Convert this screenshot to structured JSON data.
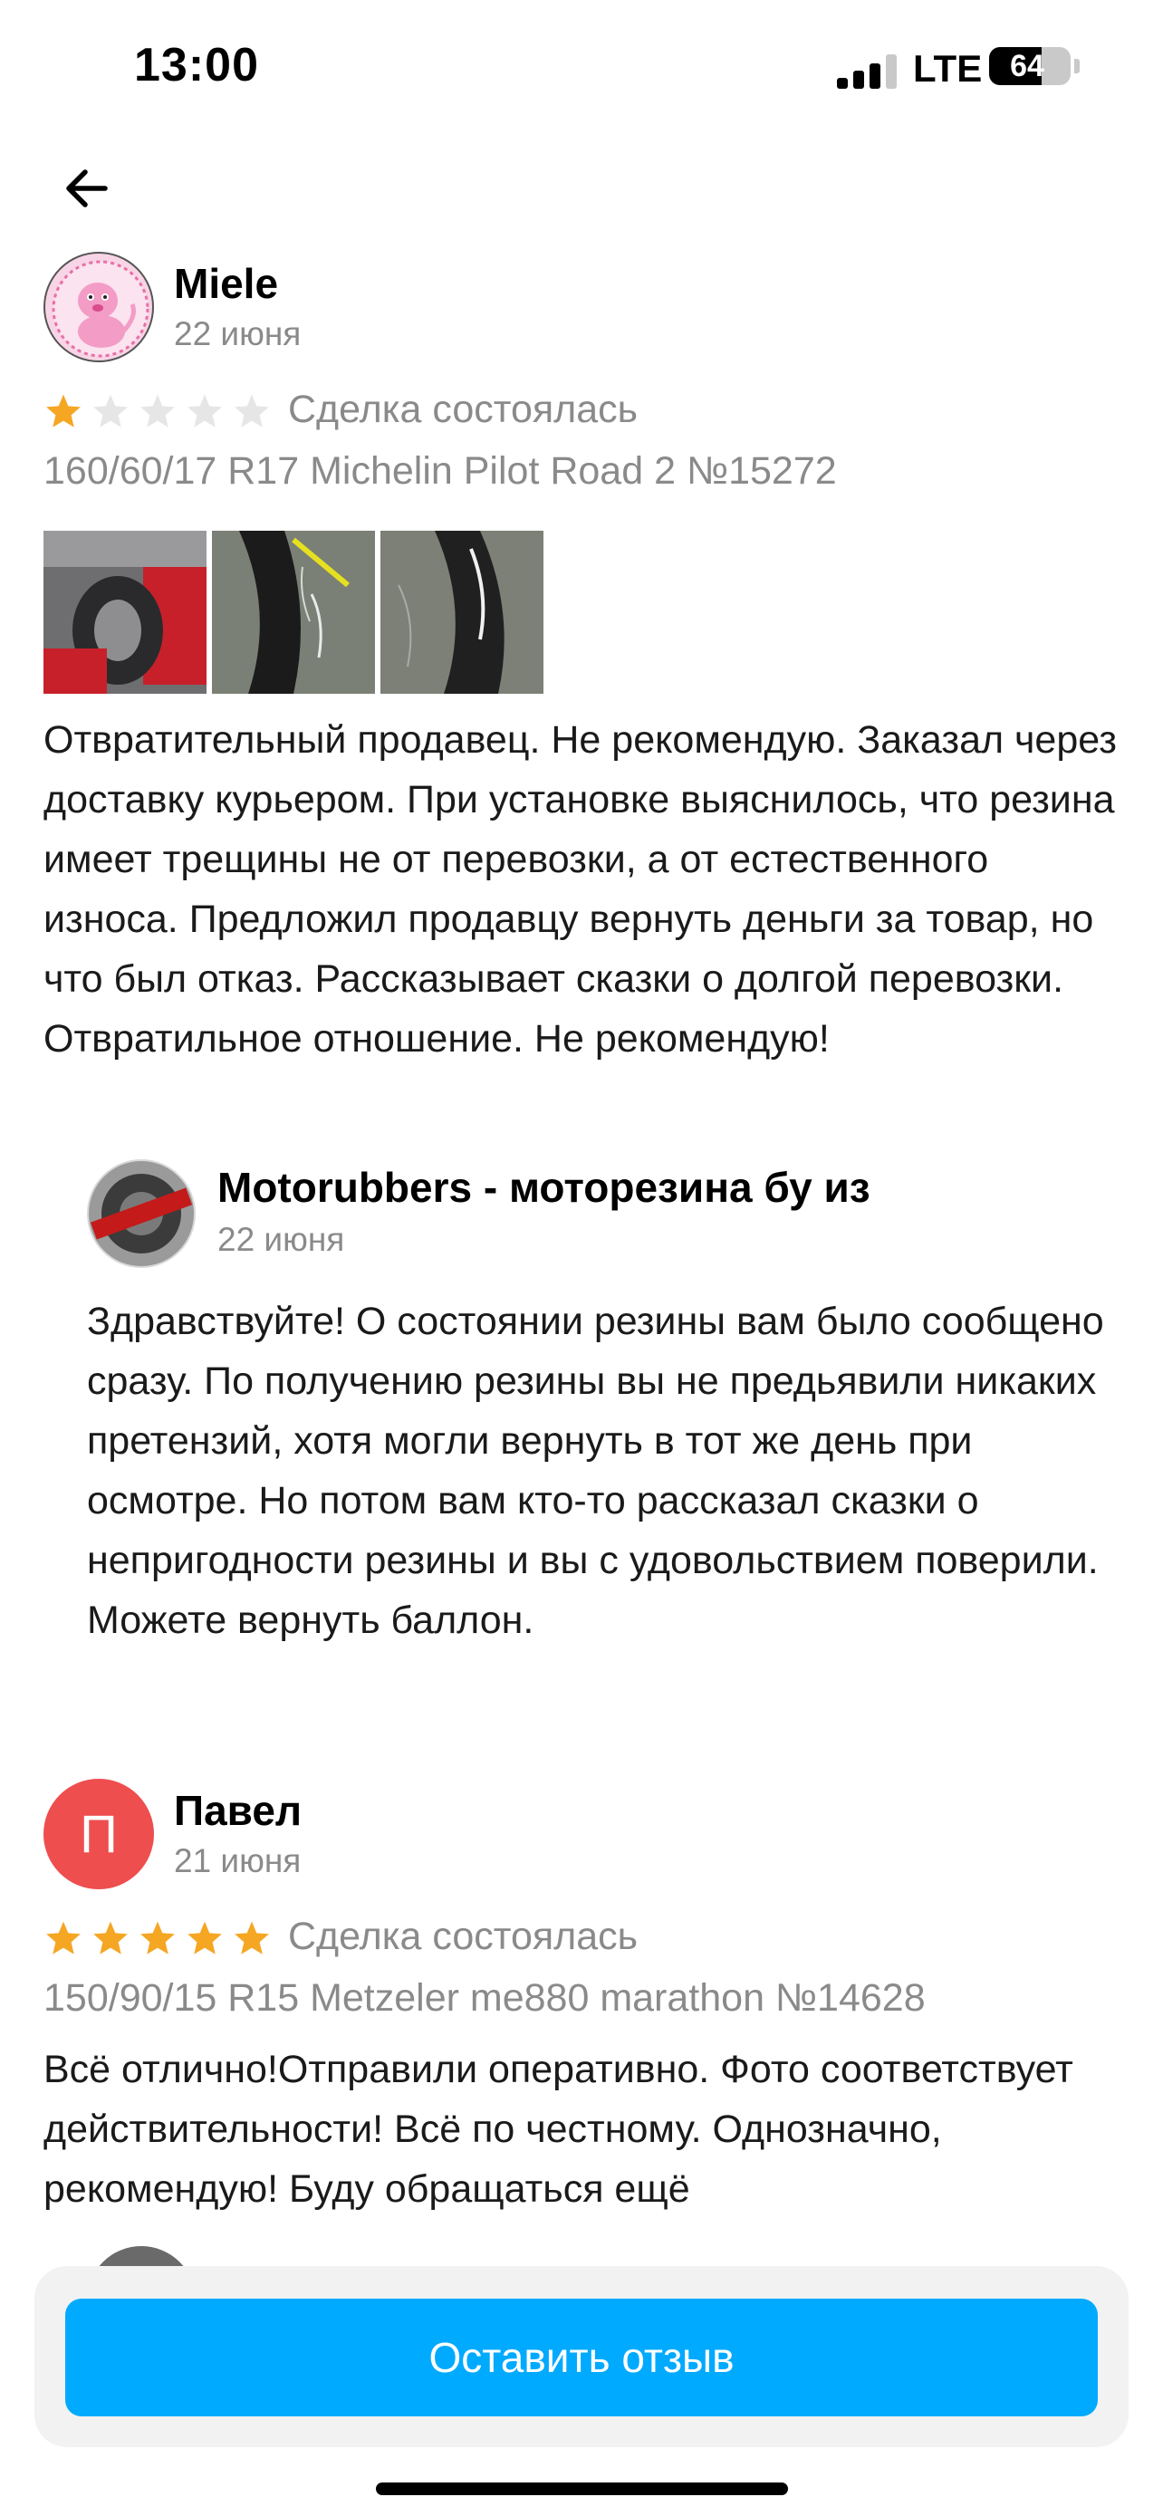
{
  "status_bar": {
    "time": "13:00",
    "network": "LTE",
    "battery": "64",
    "battery_level": 0.64
  },
  "header": {
    "back_icon": "arrow-left-icon"
  },
  "reviews": [
    {
      "author": "Miele",
      "date": "22 июня",
      "rating": 1,
      "max_rating": 5,
      "deal_status": "Сделка состоялась",
      "product": "160/60/17 R17 Michelin Pilot Road 2 №15272",
      "photos_count": 3,
      "text": "Отвратительный продавец. Не рекомендую. Заказал через доставку курьером. При установке выяснилось, что резина имеет трещины не от перевозки, а от естественного износа. Предложил продавцу вернуть деньги за товар, но что был отказ. Рассказывает сказки о долгой перевозки. Отвратильное отношение. Не рекомендую!",
      "reply": {
        "author": "Motorubbers - моторезина бу из",
        "date": "22 июня",
        "text": "Здравствуйте! О состоянии резины вам было сообщено сразу. По получению резины вы не предьявили никаких претензий, хотя могли вернуть в тот же день при осмотре. Но потом вам кто-то рассказал сказки о непригодности резины и вы с удовольствием поверили. Можете вернуть баллон."
      }
    },
    {
      "author": "Павел",
      "avatar_letter": "П",
      "date": "21 июня",
      "rating": 5,
      "max_rating": 5,
      "deal_status": "Сделка состоялась",
      "product": "150/90/15 R15 Metzeler me880 marathon №14628",
      "text": "Всё отлично!Отправили оперативно. Фото соответствует действительности! Всё по честному. Однозначно, рекомендую! Буду обращаться ещё"
    }
  ],
  "footer": {
    "leave_review": "Оставить отзыв"
  },
  "colors": {
    "accent": "#00aaff",
    "star_active": "#f5a623",
    "star_inactive": "#e6e6e6",
    "secondary_text": "#8a8a8a",
    "avatar_red": "#ee4e4e"
  }
}
